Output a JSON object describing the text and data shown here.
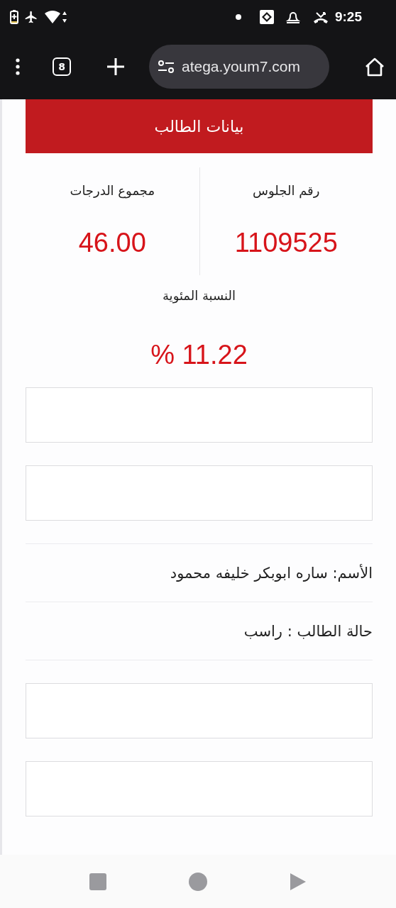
{
  "status_bar": {
    "time": "9:25"
  },
  "browser": {
    "tab_count": "8",
    "url": "atega.youm7.com"
  },
  "header": {
    "title": "بيانات الطالب"
  },
  "stats": [
    {
      "label": "رقم الجلوس",
      "value": "1109525"
    },
    {
      "label": "مجموع الدرجات",
      "value": "46.00"
    }
  ],
  "percentage": {
    "label": "النسبة المئوية",
    "value": "% 11.22"
  },
  "sections": [
    {
      "kind": "blank"
    },
    {
      "kind": "blank"
    },
    {
      "kind": "info",
      "text": "الأسم: ساره ابوبكر خليفه محمود"
    },
    {
      "kind": "info",
      "text": "حالة الطالب : راسب"
    },
    {
      "kind": "blank"
    },
    {
      "kind": "blank"
    }
  ]
}
